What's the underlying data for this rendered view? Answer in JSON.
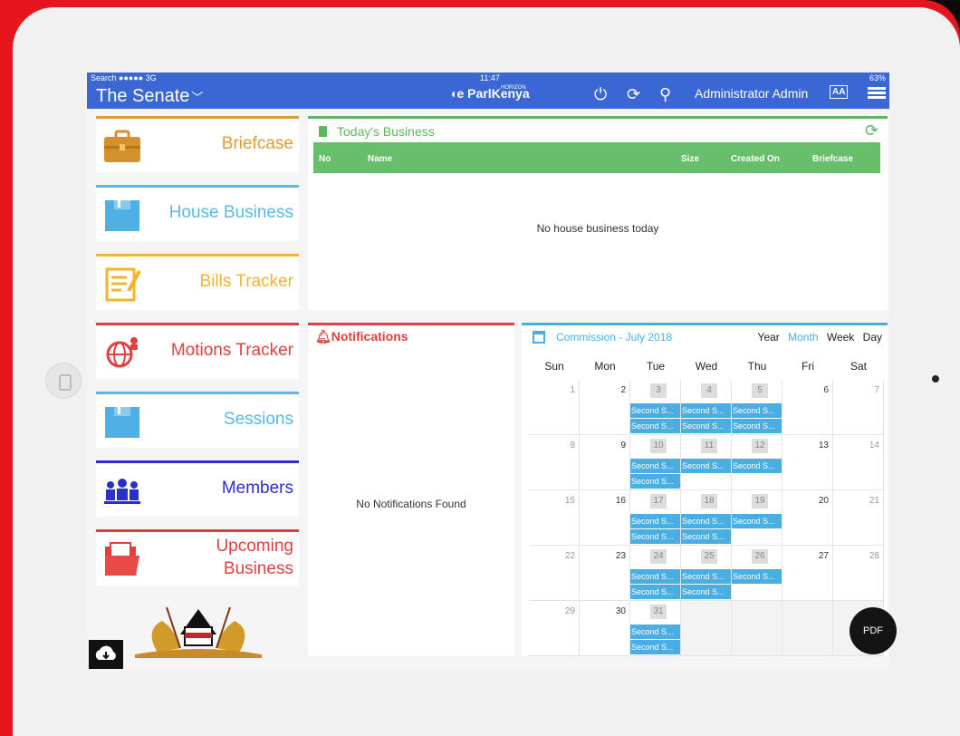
{
  "statusbar": {
    "left": "Search ●●●●● 3G",
    "time": "11:47",
    "right": "63%"
  },
  "header": {
    "title": "The Senate",
    "brand_sup": "HORIZON",
    "brand": "ParlKenya",
    "user": "Administrator Admin",
    "font_toggle": "AA"
  },
  "sidebar": [
    {
      "label": "Briefcase",
      "color": "#e09c34"
    },
    {
      "label": "House Business",
      "color": "#5ab7e8"
    },
    {
      "label": "Bills Tracker",
      "color": "#f4b629"
    },
    {
      "label": "Motions Tracker",
      "color": "#e0403f"
    },
    {
      "label": "Sessions",
      "color": "#5ab7e8"
    },
    {
      "label": "Members",
      "color": "#2b2fc7"
    },
    {
      "label": "Upcoming Business",
      "color": "#e0403f"
    }
  ],
  "today": {
    "title": "Today's Business",
    "columns": [
      "No",
      "Name",
      "Size",
      "Created On",
      "Briefcase"
    ],
    "empty": "No house business today"
  },
  "notifications": {
    "title": "Notifications",
    "empty": "No Notifications Found"
  },
  "calendar": {
    "title": "Commission - July 2018",
    "views": [
      "Year",
      "Month",
      "Week",
      "Day"
    ],
    "active_view": "Month",
    "days": [
      "Sun",
      "Mon",
      "Tue",
      "Wed",
      "Thu",
      "Fri",
      "Sat"
    ],
    "weeks": [
      [
        "1",
        "2",
        "3",
        "4",
        "5",
        "6",
        "7"
      ],
      [
        "8",
        "9",
        "10",
        "11",
        "12",
        "13",
        "14"
      ],
      [
        "15",
        "16",
        "17",
        "18",
        "19",
        "20",
        "21"
      ],
      [
        "22",
        "23",
        "24",
        "25",
        "26",
        "27",
        "28"
      ],
      [
        "29",
        "30",
        "31",
        "",
        "",
        "",
        ""
      ]
    ],
    "event_label": "Second S..."
  },
  "fab": {
    "label": "PDF"
  }
}
